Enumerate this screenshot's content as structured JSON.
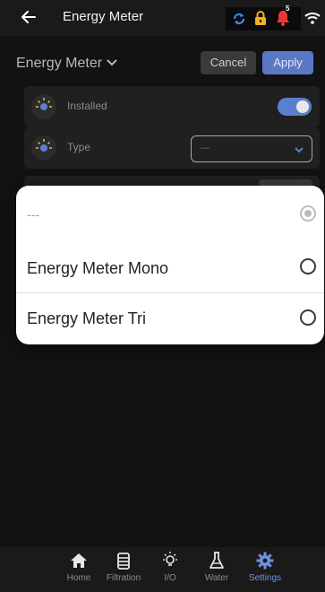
{
  "header": {
    "title": "Energy Meter",
    "notification_count": "5"
  },
  "toolbar": {
    "dropdown_title": "Energy Meter",
    "cancel_label": "Cancel",
    "apply_label": "Apply"
  },
  "rows": {
    "installed_label": "Installed",
    "installed_on": true,
    "type_label": "Type",
    "type_value": "---"
  },
  "sheet": {
    "options": [
      {
        "label": "---",
        "selected": true
      },
      {
        "label": "Energy Meter Mono",
        "selected": false
      },
      {
        "label": "Energy Meter Tri",
        "selected": false
      }
    ]
  },
  "nav": {
    "items": [
      {
        "label": "Home",
        "icon": "home-icon",
        "active": false
      },
      {
        "label": "Filtration",
        "icon": "filtration-icon",
        "active": false
      },
      {
        "label": "I/O",
        "icon": "bulb-icon",
        "active": false
      },
      {
        "label": "Water",
        "icon": "flask-icon",
        "active": false
      },
      {
        "label": "Settings",
        "icon": "gear-icon",
        "active": true
      }
    ]
  },
  "colors": {
    "accent": "#5b78c6",
    "status_sync": "#3d8ce0",
    "status_lock": "#f2b01e",
    "status_bell": "#e63a3a"
  }
}
